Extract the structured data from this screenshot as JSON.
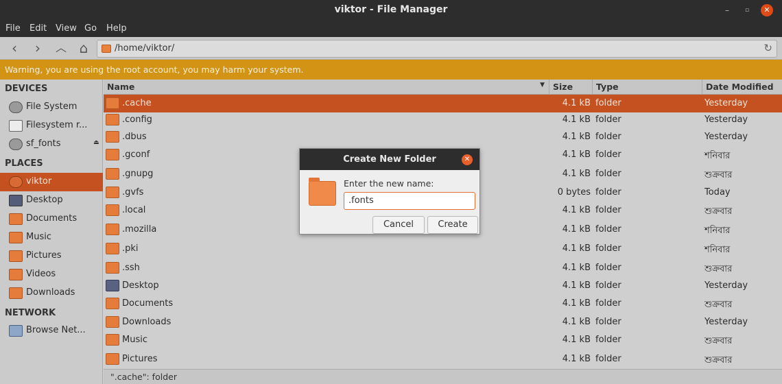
{
  "window": {
    "title": "viktor - File Manager",
    "min": "–",
    "max": "▫",
    "close": "✕"
  },
  "menubar": [
    "File",
    "Edit",
    "View",
    "Go",
    "Help"
  ],
  "toolbar": {
    "back": "‹",
    "forward": "›",
    "up": "︿",
    "home": "⌂",
    "path": "/home/viktor/",
    "reload": "↻"
  },
  "warning": "Warning, you are using the root account, you may harm your system.",
  "sidebar": {
    "devices_header": "DEVICES",
    "devices": [
      {
        "label": "File System",
        "icon": "disc-icon"
      },
      {
        "label": "Filesystem r...",
        "icon": "drive-icon"
      },
      {
        "label": "sf_fonts",
        "icon": "disc-icon",
        "eject": "⏏"
      }
    ],
    "places_header": "PLACES",
    "places": [
      {
        "label": "viktor",
        "icon": "home-icon",
        "selected": true
      },
      {
        "label": "Desktop",
        "icon": "desktop-icon"
      },
      {
        "label": "Documents",
        "icon": "folder-icon"
      },
      {
        "label": "Music",
        "icon": "folder-icon"
      },
      {
        "label": "Pictures",
        "icon": "folder-icon"
      },
      {
        "label": "Videos",
        "icon": "folder-icon"
      },
      {
        "label": "Downloads",
        "icon": "folder-icon"
      }
    ],
    "network_header": "NETWORK",
    "network": [
      {
        "label": "Browse Net...",
        "icon": "network-icon"
      }
    ]
  },
  "columns": {
    "name": "Name",
    "size": "Size",
    "type": "Type",
    "date": "Date Modified",
    "sort_indicator": "▼"
  },
  "files": [
    {
      "name": ".cache",
      "size": "4.1 kB",
      "type": "folder",
      "date": "Yesterday",
      "selected": true
    },
    {
      "name": ".config",
      "size": "4.1 kB",
      "type": "folder",
      "date": "Yesterday"
    },
    {
      "name": ".dbus",
      "size": "4.1 kB",
      "type": "folder",
      "date": "Yesterday"
    },
    {
      "name": ".gconf",
      "size": "4.1 kB",
      "type": "folder",
      "date": "শনিবার"
    },
    {
      "name": ".gnupg",
      "size": "4.1 kB",
      "type": "folder",
      "date": "শুক্রবার"
    },
    {
      "name": ".gvfs",
      "size": "0 bytes",
      "type": "folder",
      "date": "Today"
    },
    {
      "name": ".local",
      "size": "4.1 kB",
      "type": "folder",
      "date": "শুক্রবার"
    },
    {
      "name": ".mozilla",
      "size": "4.1 kB",
      "type": "folder",
      "date": "শনিবার"
    },
    {
      "name": ".pki",
      "size": "4.1 kB",
      "type": "folder",
      "date": "শনিবার"
    },
    {
      "name": ".ssh",
      "size": "4.1 kB",
      "type": "folder",
      "date": "শুক্রবার"
    },
    {
      "name": "Desktop",
      "size": "4.1 kB",
      "type": "folder",
      "date": "Yesterday",
      "desk": true
    },
    {
      "name": "Documents",
      "size": "4.1 kB",
      "type": "folder",
      "date": "শুক্রবার"
    },
    {
      "name": "Downloads",
      "size": "4.1 kB",
      "type": "folder",
      "date": "Yesterday"
    },
    {
      "name": "Music",
      "size": "4.1 kB",
      "type": "folder",
      "date": "শুক্রবার"
    },
    {
      "name": "Pictures",
      "size": "4.1 kB",
      "type": "folder",
      "date": "শুক্রবার"
    }
  ],
  "status": "\".cache\": folder",
  "dialog": {
    "title": "Create New Folder",
    "close": "✕",
    "prompt": "Enter the new name:",
    "value": ".fonts",
    "cancel": "Cancel",
    "create": "Create"
  },
  "colors": {
    "accent": "#c4511f",
    "warning": "#d39416",
    "folder": "#e67c3c",
    "titlebar": "#2d2d2d"
  }
}
